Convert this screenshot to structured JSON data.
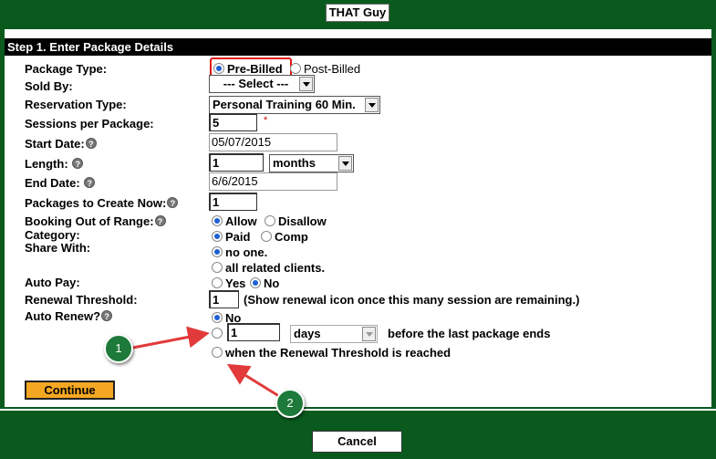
{
  "app": {
    "title": "THAT Guy"
  },
  "step": {
    "header": "Step 1. Enter Package Details"
  },
  "form": {
    "package_type": {
      "label": "Package Type:",
      "options": [
        "Pre-Billed",
        "Post-Billed"
      ],
      "selected": "Pre-Billed"
    },
    "sold_by": {
      "label": "Sold By:",
      "value": "--- Select ---"
    },
    "reservation_type": {
      "label": "Reservation Type:",
      "value": "Personal Training 60 Min."
    },
    "sessions_per_package": {
      "label": "Sessions per Package:",
      "value": "5",
      "required_mark": "*"
    },
    "start_date": {
      "label": "Start Date:",
      "value": "05/07/2015"
    },
    "length": {
      "label": "Length:",
      "value": "1",
      "unit": "months"
    },
    "end_date": {
      "label": "End Date:",
      "value": "6/6/2015"
    },
    "packages_to_create": {
      "label": "Packages to Create Now:",
      "value": "1"
    },
    "booking_out_of_range": {
      "label": "Booking Out of Range:",
      "options": [
        "Allow",
        "Disallow"
      ],
      "selected": "Allow"
    },
    "category": {
      "label": "Category:",
      "options": [
        "Paid",
        "Comp"
      ],
      "selected": "Paid"
    },
    "share_with": {
      "label": "Share With:",
      "options": [
        "no one.",
        "all related clients."
      ],
      "selected": "no one."
    },
    "auto_pay": {
      "label": "Auto Pay:",
      "options": [
        "Yes",
        "No"
      ],
      "selected": "No"
    },
    "renewal_threshold": {
      "label": "Renewal Threshold:",
      "value": "1",
      "note": "(Show renewal icon once this many session are remaining.)"
    },
    "auto_renew": {
      "label": "Auto Renew?",
      "option_no": "No",
      "days_value": "1",
      "days_unit": "days",
      "days_suffix": "before the last package ends",
      "option_threshold": "when the Renewal Threshold is reached",
      "selected": "No"
    }
  },
  "help_icon_glyph": "?",
  "buttons": {
    "continue": "Continue",
    "cancel": "Cancel"
  },
  "callouts": [
    "1",
    "2"
  ],
  "colors": {
    "frame_green": "#0a5a1e",
    "continue_orange": "#f4a722",
    "highlight_red": "#e01515"
  }
}
